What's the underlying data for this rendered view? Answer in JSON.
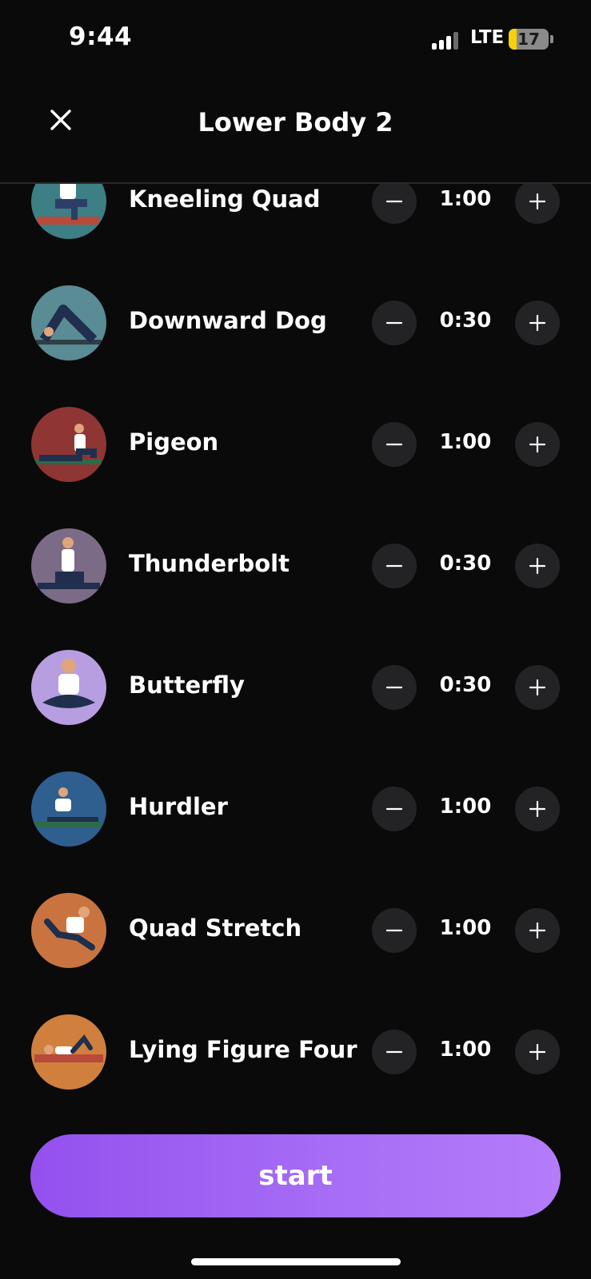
{
  "status_bar": {
    "time": "9:44",
    "network": "LTE",
    "battery": "17"
  },
  "header": {
    "title": "Lower Body 2",
    "close_icon": "close-icon"
  },
  "exercises": [
    {
      "name": "Kneeling Quad",
      "duration": "1:00",
      "avatar_color": "#3e7f86"
    },
    {
      "name": "Downward Dog",
      "duration": "0:30",
      "avatar_color": "#5a8c95"
    },
    {
      "name": "Pigeon",
      "duration": "1:00",
      "avatar_color": "#8f3534"
    },
    {
      "name": "Thunderbolt",
      "duration": "0:30",
      "avatar_color": "#7b6b86"
    },
    {
      "name": "Butterfly",
      "duration": "0:30",
      "avatar_color": "#b79ee0"
    },
    {
      "name": "Hurdler",
      "duration": "1:00",
      "avatar_color": "#2f5f8e"
    },
    {
      "name": "Quad Stretch",
      "duration": "1:00",
      "avatar_color": "#c97440"
    },
    {
      "name": "Lying Figure Four",
      "duration": "1:00",
      "avatar_color": "#d0803c"
    }
  ],
  "icons": {
    "decrement": "minus-icon",
    "increment": "plus-icon"
  },
  "start_button": {
    "label": "start"
  },
  "colors": {
    "background": "#0a0a0b",
    "stepper": "#232325",
    "accent_start": "#9450ee",
    "accent_end": "#b47cfb",
    "battery": "#f5d20b"
  }
}
